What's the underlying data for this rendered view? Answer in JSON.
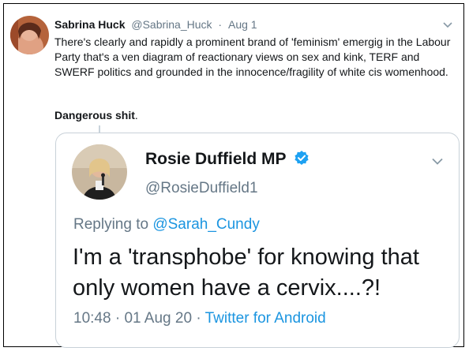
{
  "tweet": {
    "author_name": "Sabrina Huck",
    "author_handle": "@Sabrina_Huck",
    "separator": "·",
    "date": "Aug 1",
    "body_lines": [
      "There's clearly and rapidly a prominent brand of 'feminism' emergig in the Labour Party that's a ven diagram of reactionary views on sex and kink, TERF and SWERF politics and grounded in the innocence/fragility of white cis womenhood."
    ],
    "closing_bold": "Dangerous shit",
    "closing_punct": ".",
    "avatar_icon": "user-avatar-icon",
    "menu_icon": "chevron-down-icon"
  },
  "quoted": {
    "author_name": "Rosie Duffield MP",
    "author_handle": "@RosieDuffield1",
    "verified_icon": "verified-badge-icon",
    "replying_prefix": "Replying to ",
    "replying_to": "@Sarah_Cundy",
    "text": "I'm a 'transphobe' for knowing that only women have a cervix....?!",
    "time": "10:48",
    "sep1": "·",
    "date": "01 Aug 20",
    "sep2": "·",
    "source": "Twitter for Android",
    "accent_color": "#1b95e0"
  }
}
